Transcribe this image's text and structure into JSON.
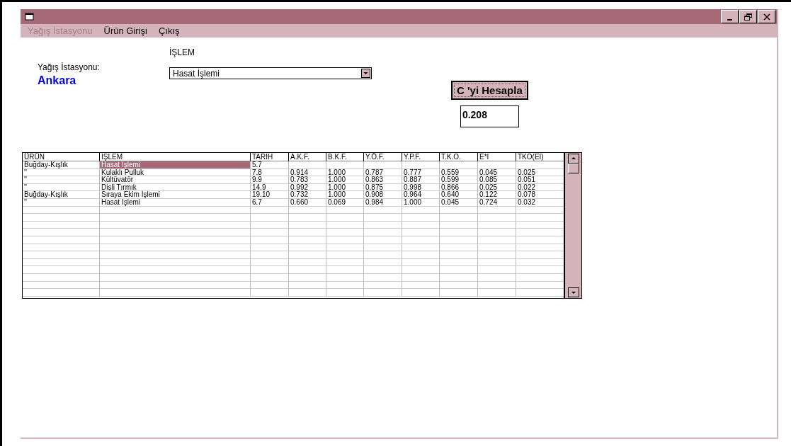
{
  "menu": [
    {
      "label": "Yağış İstasyonu",
      "disabled": true
    },
    {
      "label": "Ürün Girişi",
      "disabled": false
    },
    {
      "label": "Çıkış",
      "disabled": false
    }
  ],
  "islem": {
    "label": "İŞLEM",
    "value": "Hasat İşlemi"
  },
  "station": {
    "label": "Yağış İstasyonu:",
    "value": "Ankara"
  },
  "calculate_button": "C 'yi Hesapla",
  "result": "0.208",
  "table": {
    "columns": [
      "ÜRÜN",
      "İŞLEM",
      "TARİH",
      "A.K.F.",
      "B.K.F.",
      "Y.Ö.F.",
      "Y.P.F.",
      "T.K.O.",
      "E*I",
      "TKO(EI)"
    ],
    "rows": [
      {
        "cells": [
          {
            "text": "Buğday-Kışlık",
            "selected": false
          },
          {
            "text": "Hasat İşlemi",
            "selected": true
          },
          {
            "text": "5.7",
            "selected": false
          }
        ]
      },
      {
        "cells": [
          {
            "text": "''",
            "selected": false
          },
          {
            "text": "Kulaklı Pulluk",
            "selected": false
          },
          {
            "text": "7.8",
            "selected": false
          },
          {
            "text": "0.914",
            "selected": false
          },
          {
            "text": "1.000",
            "selected": false
          },
          {
            "text": "0.787",
            "selected": false
          },
          {
            "text": "0.777",
            "selected": false
          },
          {
            "text": "0.559",
            "selected": false
          },
          {
            "text": "0.045",
            "selected": false
          },
          {
            "text": "0.025",
            "selected": false
          }
        ]
      },
      {
        "cells": [
          {
            "text": "''",
            "selected": false
          },
          {
            "text": "Kültüvatör",
            "selected": false
          },
          {
            "text": "9.9",
            "selected": false
          },
          {
            "text": "0.783",
            "selected": false
          },
          {
            "text": "1.000",
            "selected": false
          },
          {
            "text": "0.863",
            "selected": false
          },
          {
            "text": "0.887",
            "selected": false
          },
          {
            "text": "0.599",
            "selected": false
          },
          {
            "text": "0.085",
            "selected": false
          },
          {
            "text": "0.051",
            "selected": false
          }
        ]
      },
      {
        "cells": [
          {
            "text": "''",
            "selected": false
          },
          {
            "text": "Dişli Tırmık",
            "selected": false
          },
          {
            "text": "14.9",
            "selected": false
          },
          {
            "text": "0.992",
            "selected": false
          },
          {
            "text": "1.000",
            "selected": false
          },
          {
            "text": "0.875",
            "selected": false
          },
          {
            "text": "0.998",
            "selected": false
          },
          {
            "text": "0.866",
            "selected": false
          },
          {
            "text": "0.025",
            "selected": false
          },
          {
            "text": "0.022",
            "selected": false
          }
        ]
      },
      {
        "cells": [
          {
            "text": "Buğday-Kışlık",
            "selected": false
          },
          {
            "text": "Sıraya Ekim İşlemi",
            "selected": false
          },
          {
            "text": "19.10",
            "selected": false
          },
          {
            "text": "0.732",
            "selected": false
          },
          {
            "text": "1.000",
            "selected": false
          },
          {
            "text": "0.908",
            "selected": false
          },
          {
            "text": "0.964",
            "selected": false
          },
          {
            "text": "0.640",
            "selected": false
          },
          {
            "text": "0.122",
            "selected": false
          },
          {
            "text": "0.078",
            "selected": false
          }
        ]
      },
      {
        "cells": [
          {
            "text": "''",
            "selected": false
          },
          {
            "text": "Hasat İşlemi",
            "selected": false
          },
          {
            "text": "6.7",
            "selected": false
          },
          {
            "text": "0.660",
            "selected": false
          },
          {
            "text": "0.069",
            "selected": false
          },
          {
            "text": "0.984",
            "selected": false
          },
          {
            "text": "1.000",
            "selected": false
          },
          {
            "text": "0.045",
            "selected": false
          },
          {
            "text": "0.724",
            "selected": false
          },
          {
            "text": "0.032",
            "selected": false
          }
        ]
      }
    ]
  }
}
